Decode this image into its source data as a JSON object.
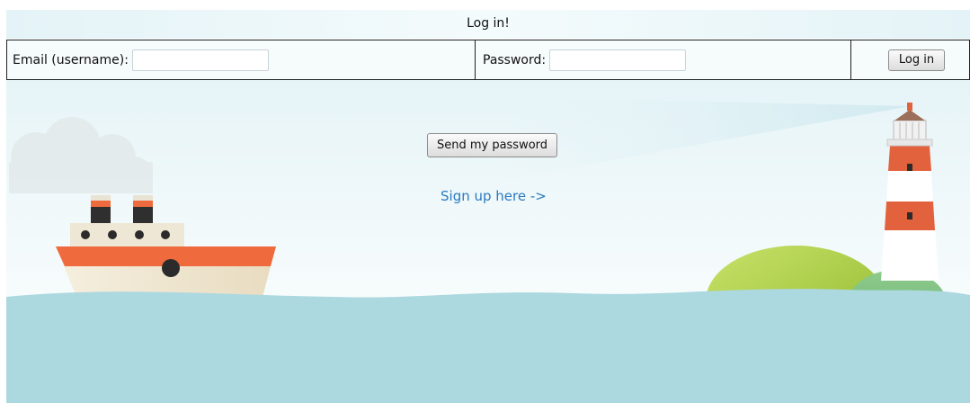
{
  "header": {
    "title": "Log in!"
  },
  "login_form": {
    "email_label": "Email (username):",
    "email_value": "",
    "email_placeholder": "",
    "password_label": "Password:",
    "password_value": "",
    "password_placeholder": "",
    "login_button": "Log in"
  },
  "actions": {
    "send_password_button": "Send my password",
    "signup_link": "Sign up here ->"
  },
  "illustration": {
    "sea_color": "#acd8e0",
    "hill_color": "#9ec63b",
    "accent_color": "#ef6a3c",
    "icons": [
      "ship-illustration",
      "lighthouse-illustration",
      "cloud-illustration",
      "hill-illustration"
    ]
  }
}
